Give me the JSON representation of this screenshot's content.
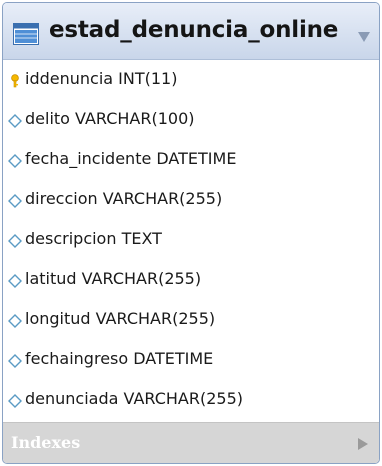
{
  "table": {
    "name": "estad_denuncia_online",
    "icon": "table-icon",
    "columns": [
      {
        "text": "iddenuncia INT(11)",
        "icon": "primary-key-icon"
      },
      {
        "text": "delito VARCHAR(100)",
        "icon": "column-diamond-icon"
      },
      {
        "text": "fecha_incidente DATETIME",
        "icon": "column-diamond-icon"
      },
      {
        "text": "direccion VARCHAR(255)",
        "icon": "column-diamond-icon"
      },
      {
        "text": "descripcion TEXT",
        "icon": "column-diamond-icon"
      },
      {
        "text": "latitud VARCHAR(255)",
        "icon": "column-diamond-icon"
      },
      {
        "text": "longitud VARCHAR(255)",
        "icon": "column-diamond-icon"
      },
      {
        "text": "fechaingreso DATETIME",
        "icon": "column-diamond-icon"
      },
      {
        "text": "denunciada VARCHAR(255)",
        "icon": "column-diamond-icon"
      }
    ],
    "indexes_label": "Indexes"
  },
  "colors": {
    "header_gradient_top": "#e8eef8",
    "header_gradient_bottom": "#c9d6ea",
    "border": "#8aa2c4",
    "key_icon": "#f5b800",
    "diamond_icon": "#5a9bc4",
    "indexes_bar": "#d6d6d6"
  }
}
